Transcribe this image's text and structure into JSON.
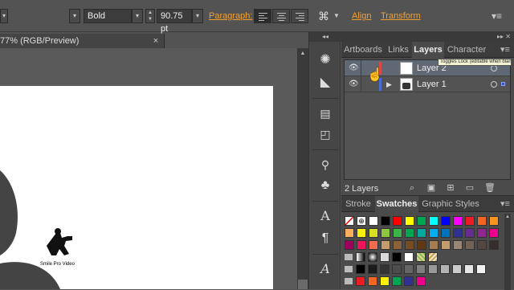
{
  "control_bar": {
    "font_style": "Bold",
    "font_size": "90.75 pt",
    "paragraph_label": "Paragraph:",
    "align_label": "Align",
    "transform_label": "Transform"
  },
  "document": {
    "tab_title": "77% (RGB/Preview)",
    "close_glyph": "×"
  },
  "layers_panel": {
    "tabs": [
      "Artboards",
      "Links",
      "Layers",
      "Character"
    ],
    "active_tab": "Layers",
    "tooltip": "Toggles Lock (editable when blank)",
    "layers": [
      {
        "name": "Layer 2",
        "color": "#d84a4a"
      },
      {
        "name": "Layer 1",
        "color": "#4a6cd8"
      }
    ],
    "count_label": "2 Layers"
  },
  "swatches_panel": {
    "tabs": [
      "Stroke",
      "Swatches",
      "Graphic Styles"
    ],
    "active_tab": "Swatches",
    "rows": [
      [
        "#ffffff",
        "#ffffff",
        "#ffffff",
        "#000000",
        "#ff0000",
        "#ffff00",
        "#00a651",
        "#00ffff",
        "#0000ff",
        "#ff00ff",
        "#ed1c24",
        "#f26522",
        "#f7941d"
      ],
      [
        "#fbaf5d",
        "#fff200",
        "#d7df23",
        "#8dc63f",
        "#39b54a",
        "#00a651",
        "#00a99d",
        "#00aeef",
        "#0072bc",
        "#2e3192",
        "#662d91",
        "#92278f",
        "#ec008c"
      ],
      [
        "#9e005d",
        "#ed145b",
        "#f26c4f",
        "#c69c6d",
        "#8c6239",
        "#754c24",
        "#603913",
        "#a67c52",
        "#c69c6d",
        "#998675",
        "#736357",
        "#534741",
        "#362f2d"
      ],
      [
        "#ffffff",
        "#f2f2f2",
        "#d9d9d9",
        "#000000",
        "#ffffff",
        "#cfa35a",
        "#b98a4a"
      ],
      [
        "#000000",
        "#1a1a1a",
        "#333333",
        "#4d4d4d",
        "#666666",
        "#808080",
        "#999999",
        "#b3b3b3",
        "#cccccc",
        "#e6e6e6",
        "#f2f2f2"
      ],
      [
        "#ed1c24",
        "#f26522",
        "#fff200",
        "#00a651",
        "#2e3192",
        "#ec008c"
      ]
    ]
  },
  "logo": {
    "caption": "Smile Pro Video"
  },
  "colors": {
    "accent_orange": "#f0a030",
    "layer_selected": "#5f6873"
  }
}
